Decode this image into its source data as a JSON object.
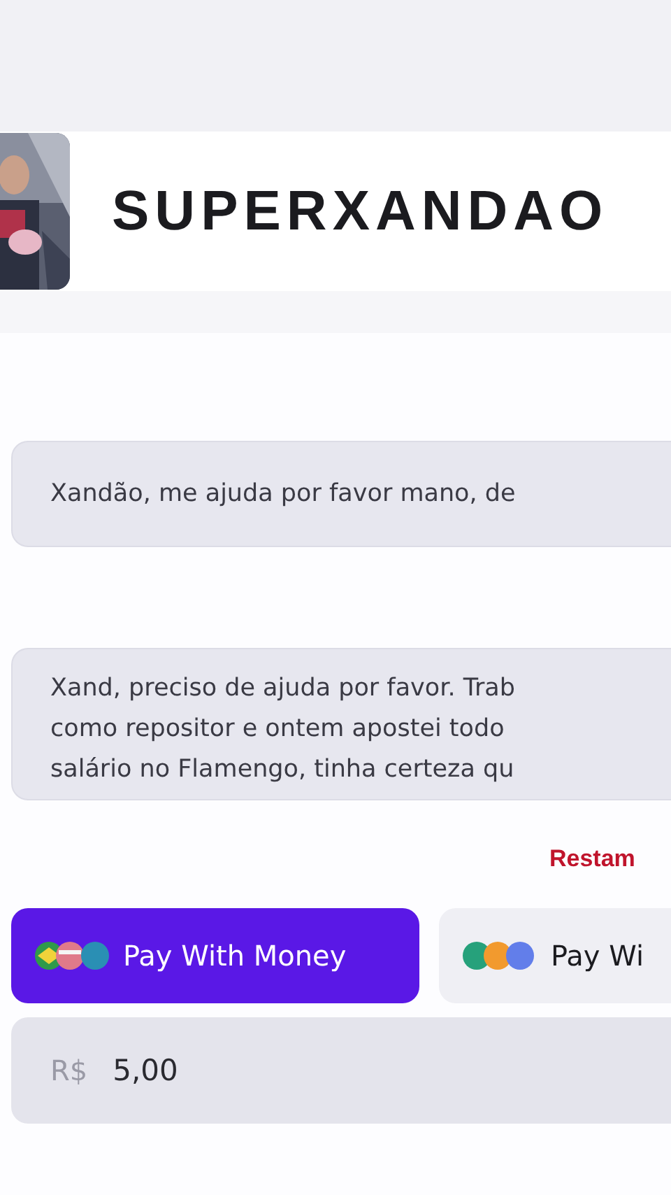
{
  "header": {
    "title": "SUPERXANDAO"
  },
  "messages": [
    {
      "lines": [
        "Xandão, me ajuda por favor mano, de"
      ]
    },
    {
      "lines": [
        "Xand, preciso de ajuda por favor. Trab",
        "como repositor e ontem apostei todo",
        "salário no Flamengo, tinha certeza qu"
      ]
    }
  ],
  "notice": "Restam",
  "payment_tabs": [
    {
      "label": "Pay With Money",
      "kind": "money",
      "selected": true
    },
    {
      "label": "Pay Wi",
      "kind": "crypto",
      "selected": false
    }
  ],
  "amount_field": {
    "prefix": "R$",
    "value": "5,00"
  }
}
